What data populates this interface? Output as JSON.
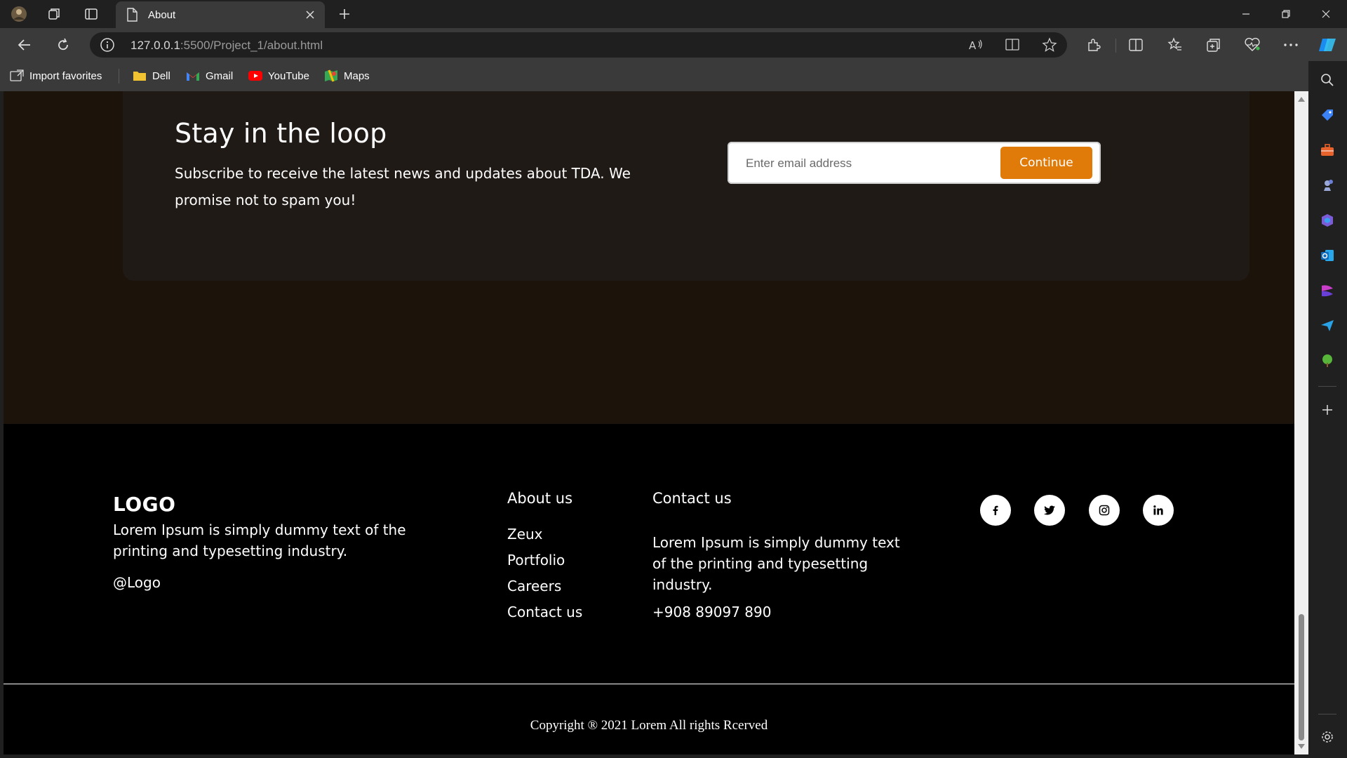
{
  "browser": {
    "tab_title": "About",
    "url_host": "127.0.0.1",
    "url_path": ":5500/Project_1/about.html",
    "favorites": [
      {
        "label": "Import favorites",
        "icon": "import-icon"
      },
      {
        "label": "Dell",
        "icon": "folder-icon"
      },
      {
        "label": "Gmail",
        "icon": "gmail-icon"
      },
      {
        "label": "YouTube",
        "icon": "youtube-icon"
      },
      {
        "label": "Maps",
        "icon": "maps-icon"
      }
    ]
  },
  "newsletter": {
    "title": "Stay in the loop",
    "description": "Subscribe to receive the latest news and updates about TDA. We promise not to spam you!",
    "email_placeholder": "Enter email address",
    "button_label": "Continue"
  },
  "footer": {
    "logo": "LOGO",
    "description": "Lorem Ipsum is simply dummy text of the printing and typesetting industry.",
    "handle": "@Logo",
    "about_title": "About us",
    "about_links": [
      "Zeux",
      "Portfolio",
      "Careers",
      "Contact us"
    ],
    "contact_title": "Contact us",
    "contact_description": "Lorem Ipsum is simply dummy text of the printing and typesetting industry.",
    "phone": "+908 89097 890",
    "social": [
      {
        "name": "facebook",
        "glyph": "f"
      },
      {
        "name": "twitter",
        "glyph": "t"
      },
      {
        "name": "instagram",
        "glyph": "ig"
      },
      {
        "name": "linkedin",
        "glyph": "in"
      }
    ],
    "copyright": "Copyright ® 2021 Lorem All rights Rcerved"
  },
  "colors": {
    "accent": "#e07a08",
    "hero_bg": "#1c130b",
    "card_bg": "#201a17",
    "footer_bg": "#000000"
  }
}
